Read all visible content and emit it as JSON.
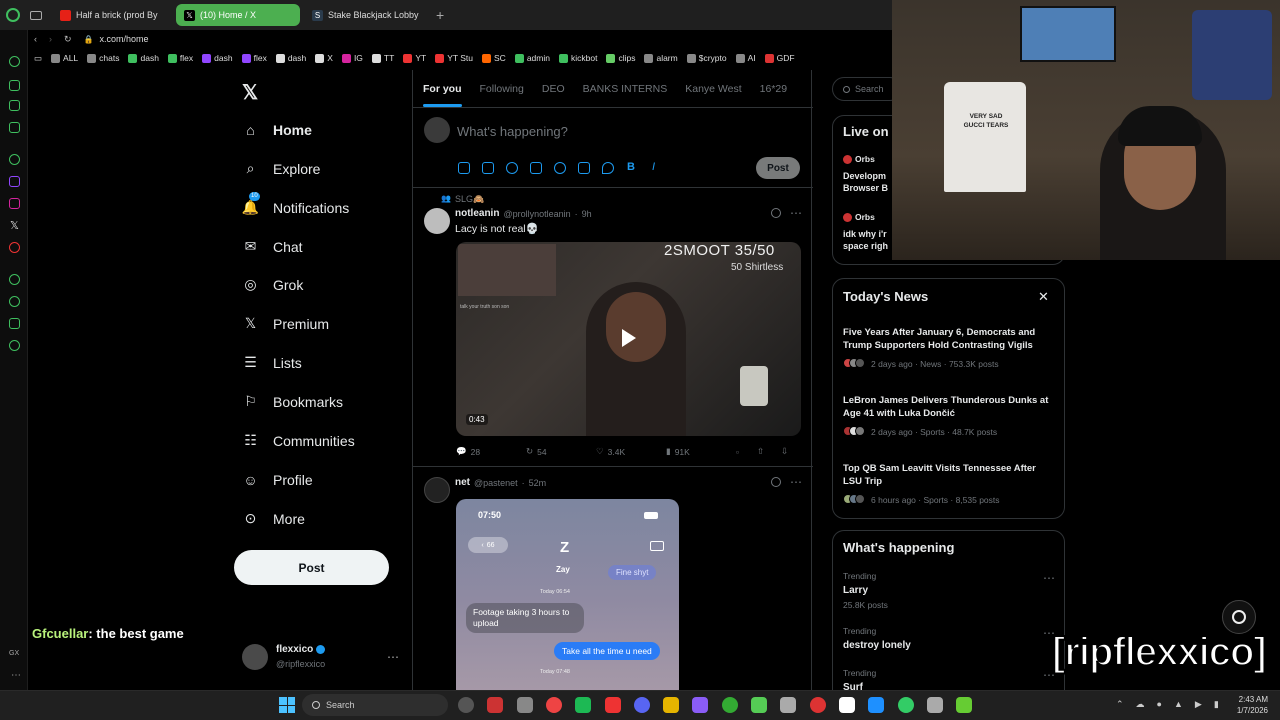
{
  "browser": {
    "tabs": [
      {
        "label": "Half a brick (prod By",
        "active": false
      },
      {
        "label": "(10) Home / X",
        "active": true
      },
      {
        "label": "Stake Blackjack Lobby",
        "active": false
      }
    ],
    "url": "x.com/home",
    "bookmarks": [
      "ALL",
      "chats",
      "dash",
      "flex",
      "dash",
      "flex",
      "dash",
      "X",
      "IG",
      "TT",
      "YT",
      "YT Stu",
      "SC",
      "admin",
      "kickbot",
      "clips",
      "alarm",
      "$crypto",
      "AI",
      "GDF"
    ]
  },
  "nav": {
    "items": [
      "Home",
      "Explore",
      "Notifications",
      "Chat",
      "Grok",
      "Premium",
      "Lists",
      "Bookmarks",
      "Communities",
      "Profile",
      "More"
    ],
    "notif_badge": "10",
    "post_label": "Post",
    "account_name": "flexxico",
    "account_handle": "@ripflexxico"
  },
  "feed": {
    "tabs": [
      "For you",
      "Following",
      "DEO",
      "BANKS INTERNS",
      "Kanye West",
      "16*29"
    ],
    "composer_placeholder": "What's happening?",
    "composer_post": "Post",
    "posts": [
      {
        "social_context": "SLG🙈",
        "name": "notleanin",
        "handle": "@prollynotleanin",
        "time": "9h",
        "text": "Lacy is not real💀",
        "video_overlay": "2SMOOT  35/50",
        "video_overlay2": "50 Shirtless",
        "video_chat": "talk your truth son son",
        "duration": "0:43",
        "replies": "28",
        "reposts": "54",
        "likes": "3.4K",
        "views": "91K"
      },
      {
        "name": "net",
        "handle": "@pastenet",
        "time": "52m",
        "phone": {
          "clock": "07:50",
          "back_badge": "66",
          "contact_initial": "Z",
          "contact_name": "Zay",
          "date1": "Today 06:54",
          "msg_in": "Fine shyt",
          "msg_out1": "Footage taking 3 hours to upload",
          "msg_out2": "Take all the time u need",
          "date2": "Today 07:48"
        }
      }
    ]
  },
  "right": {
    "search_placeholder": "Search",
    "live_title": "Live on",
    "live_items": [
      {
        "host": "Orbs",
        "title": "Developm Browser B"
      },
      {
        "host": "Orbs",
        "title": "idk why i'r space righ"
      }
    ],
    "news_title": "Today's News",
    "news": [
      {
        "title": "Five Years After January 6, Democrats and Trump Supporters Hold Contrasting Vigils",
        "meta": "2 days ago · News · 753.3K posts"
      },
      {
        "title": "LeBron James Delivers Thunderous Dunks at Age 41 with Luka Dončić",
        "meta": "2 days ago · Sports · 48.7K posts"
      },
      {
        "title": "Top QB Sam Leavitt Visits Tennessee After LSU Trip",
        "meta": "6 hours ago · Sports · 8,535 posts"
      }
    ],
    "happening_title": "What's happening",
    "trends": [
      {
        "label": "Trending",
        "name": "Larry",
        "posts": "25.8K posts"
      },
      {
        "label": "Trending",
        "name": "destroy lonely",
        "posts": ""
      },
      {
        "label": "Trending",
        "name": "Surf",
        "posts": ""
      }
    ]
  },
  "overlay": {
    "chat_user": "Gfcuellar",
    "chat_msg": ": the best game",
    "watermark": "[ripflexxico]",
    "tshirt": "VERY SAD GUCCI TEARS"
  },
  "taskbar": {
    "search": "Search",
    "time": "2:43 AM",
    "date": "1/7/2026"
  },
  "colors": {
    "accent": "#1d9bf0",
    "tab_active": "#4caf50",
    "rail": "#3fbf5f"
  }
}
